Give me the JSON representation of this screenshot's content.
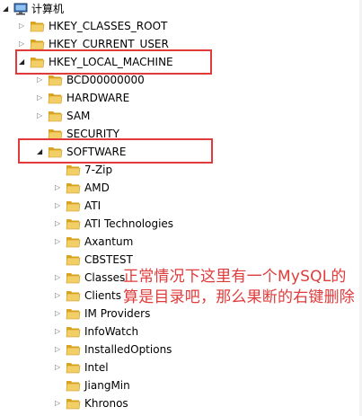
{
  "tree": {
    "root_label": "计算机",
    "items": [
      {
        "label": "HKEY_CLASSES_ROOT",
        "expanded": false,
        "has_children": true
      },
      {
        "label": "HKEY_CURRENT_USER",
        "expanded": false,
        "has_children": true
      },
      {
        "label": "HKEY_LOCAL_MACHINE",
        "expanded": true,
        "has_children": true
      },
      {
        "label": "BCD00000000",
        "expanded": false,
        "has_children": true
      },
      {
        "label": "HARDWARE",
        "expanded": false,
        "has_children": true
      },
      {
        "label": "SAM",
        "expanded": false,
        "has_children": true
      },
      {
        "label": "SECURITY",
        "expanded": false,
        "has_children": false
      },
      {
        "label": "SOFTWARE",
        "expanded": true,
        "has_children": true
      },
      {
        "label": "7-Zip",
        "expanded": false,
        "has_children": false
      },
      {
        "label": "AMD",
        "expanded": false,
        "has_children": true
      },
      {
        "label": "ATI",
        "expanded": false,
        "has_children": true
      },
      {
        "label": "ATI Technologies",
        "expanded": false,
        "has_children": true
      },
      {
        "label": "Axantum",
        "expanded": false,
        "has_children": true
      },
      {
        "label": "CBSTEST",
        "expanded": false,
        "has_children": false
      },
      {
        "label": "Classes",
        "expanded": false,
        "has_children": true
      },
      {
        "label": "Clients",
        "expanded": false,
        "has_children": true
      },
      {
        "label": "IM Providers",
        "expanded": false,
        "has_children": true
      },
      {
        "label": "InfoWatch",
        "expanded": false,
        "has_children": true
      },
      {
        "label": "InstalledOptions",
        "expanded": false,
        "has_children": true
      },
      {
        "label": "Intel",
        "expanded": false,
        "has_children": true
      },
      {
        "label": "JiangMin",
        "expanded": false,
        "has_children": false
      },
      {
        "label": "Khronos",
        "expanded": false,
        "has_children": true
      }
    ]
  },
  "annotation": {
    "text": "正常情况下这里有一个MySQL的算是目录吧，那么果断的右键删除"
  },
  "colors": {
    "highlight_box": "#e03a3a",
    "annotation_text": "#e03b3b",
    "folder_fill": "#f2cf66",
    "folder_dark": "#d9a520"
  }
}
